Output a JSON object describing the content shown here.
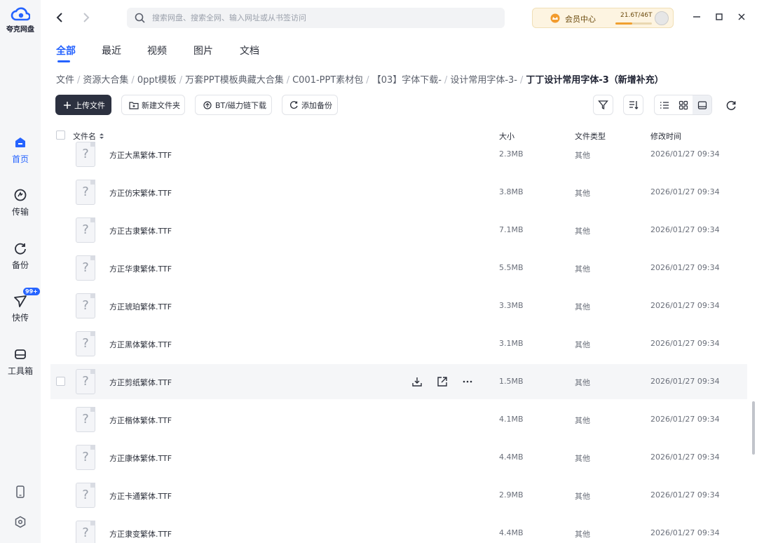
{
  "app": {
    "name": "夸克网盘"
  },
  "sidebar": {
    "items": [
      {
        "label": "首页",
        "icon": "home-icon",
        "active": true
      },
      {
        "label": "传输",
        "icon": "transfer-icon",
        "active": false
      },
      {
        "label": "备份",
        "icon": "backup-icon",
        "active": false
      },
      {
        "label": "快传",
        "icon": "send-icon",
        "active": false,
        "badge": "99+"
      },
      {
        "label": "工具箱",
        "icon": "toolbox-icon",
        "active": false
      }
    ],
    "bottom": [
      {
        "icon": "phone-icon"
      },
      {
        "icon": "settings-icon"
      }
    ]
  },
  "search": {
    "placeholder": "搜索网盘、搜索全网、输入网址或从书签访问"
  },
  "vip": {
    "label": "会员中心",
    "quota": "21.6T/46T",
    "quota_used_fraction": 0.47
  },
  "tabs": [
    {
      "label": "全部",
      "active": true
    },
    {
      "label": "最近",
      "active": false
    },
    {
      "label": "视频",
      "active": false
    },
    {
      "label": "图片",
      "active": false
    },
    {
      "label": "文档",
      "active": false
    }
  ],
  "breadcrumb": [
    "文件",
    "资源大合集",
    "0ppt模板",
    "万套PPT模板典藏大合集",
    "C001-PPT素材包",
    "【03】字体下载-",
    "设计常用字体-3-",
    "丁丁设计常用字体-3（新增补充）"
  ],
  "toolbar": {
    "upload": "上传文件",
    "new_folder": "新建文件夹",
    "bt": "BT/磁力链下载",
    "add_backup": "添加备份"
  },
  "columns": {
    "name": "文件名",
    "size": "大小",
    "type": "文件类型",
    "time": "修改时间"
  },
  "files": [
    {
      "name": "方正大黑繁体.TTF",
      "size": "2.3MB",
      "type": "其他",
      "time": "2026/01/27 09:34"
    },
    {
      "name": "方正仿宋繁体.TTF",
      "size": "3.8MB",
      "type": "其他",
      "time": "2026/01/27 09:34"
    },
    {
      "name": "方正古隶繁体.TTF",
      "size": "7.1MB",
      "type": "其他",
      "time": "2026/01/27 09:34"
    },
    {
      "name": "方正华隶繁体.TTF",
      "size": "5.5MB",
      "type": "其他",
      "time": "2026/01/27 09:34"
    },
    {
      "name": "方正琥珀繁体.TTF",
      "size": "3.3MB",
      "type": "其他",
      "time": "2026/01/27 09:34"
    },
    {
      "name": "方正黑体繁体.TTF",
      "size": "3.1MB",
      "type": "其他",
      "time": "2026/01/27 09:34"
    },
    {
      "name": "方正剪纸繁体.TTF",
      "size": "1.5MB",
      "type": "其他",
      "time": "2026/01/27 09:34",
      "hover": true
    },
    {
      "name": "方正楷体繁体.TTF",
      "size": "4.1MB",
      "type": "其他",
      "time": "2026/01/27 09:34"
    },
    {
      "name": "方正康体繁体.TTF",
      "size": "4.4MB",
      "type": "其他",
      "time": "2026/01/27 09:34"
    },
    {
      "name": "方正卡通繁体.TTF",
      "size": "2.9MB",
      "type": "其他",
      "time": "2026/01/27 09:34"
    },
    {
      "name": "方正隶变繁体.TTF",
      "size": "4.4MB",
      "type": "其他",
      "time": "2026/01/27 09:34"
    }
  ],
  "file_icon_glyph": "?",
  "colors": {
    "accent": "#2563ff",
    "primary_button": "#2c3140",
    "vip_bg": "#fdf4e1"
  }
}
